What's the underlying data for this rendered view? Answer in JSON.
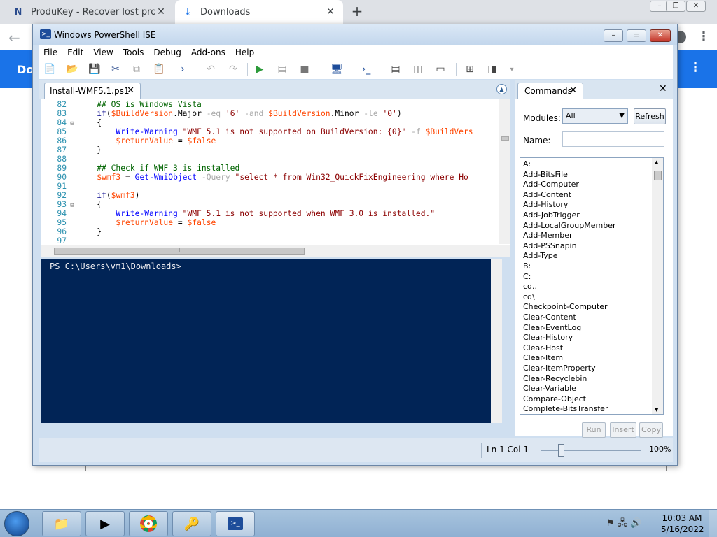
{
  "browser": {
    "tabs": [
      {
        "label": "ProduKey - Recover lost product",
        "icon": "N"
      },
      {
        "label": "Downloads",
        "icon": "download-icon"
      }
    ],
    "new_tab": "+",
    "page_title": "Dow"
  },
  "ise": {
    "title": "Windows PowerShell ISE",
    "menu": [
      "File",
      "Edit",
      "View",
      "Tools",
      "Debug",
      "Add-ons",
      "Help"
    ],
    "script_tab": "Install-WMF5.1.ps1",
    "code_lines": [
      {
        "n": "82",
        "fold": "",
        "text": "    ## OS is Windows Vista"
      },
      {
        "n": "83",
        "fold": "",
        "text": "    if($BuildVersion.Major -eq '6' -and $BuildVersion.Minor -le '0')"
      },
      {
        "n": "84",
        "fold": "⊟",
        "text": "    {"
      },
      {
        "n": "85",
        "fold": "",
        "text": "        Write-Warning \"WMF 5.1 is not supported on BuildVersion: {0}\" -f $BuildVers"
      },
      {
        "n": "86",
        "fold": "",
        "text": "        $returnValue = $false"
      },
      {
        "n": "87",
        "fold": "",
        "text": "    }"
      },
      {
        "n": "88",
        "fold": "",
        "text": ""
      },
      {
        "n": "89",
        "fold": "",
        "text": "    ## Check if WMF 3 is installed"
      },
      {
        "n": "90",
        "fold": "",
        "text": "    $wmf3 = Get-WmiObject -Query \"select * from Win32_QuickFixEngineering where Ho"
      },
      {
        "n": "91",
        "fold": "",
        "text": ""
      },
      {
        "n": "92",
        "fold": "",
        "text": "    if($wmf3)"
      },
      {
        "n": "93",
        "fold": "⊟",
        "text": "    {"
      },
      {
        "n": "94",
        "fold": "",
        "text": "        Write-Warning \"WMF 5.1 is not supported when WMF 3.0 is installed.\""
      },
      {
        "n": "95",
        "fold": "",
        "text": "        $returnValue = $false"
      },
      {
        "n": "96",
        "fold": "",
        "text": "    }"
      },
      {
        "n": "97",
        "fold": "",
        "text": ""
      }
    ],
    "console_prompt": "PS C:\\Users\\vm1\\Downloads>",
    "commands": {
      "tab_label": "Commands",
      "modules_label": "Modules:",
      "modules_value": "All",
      "refresh_label": "Refresh",
      "name_label": "Name:",
      "items": [
        "A:",
        "Add-BitsFile",
        "Add-Computer",
        "Add-Content",
        "Add-History",
        "Add-JobTrigger",
        "Add-LocalGroupMember",
        "Add-Member",
        "Add-PSSnapin",
        "Add-Type",
        "B:",
        "C:",
        "cd..",
        "cd\\",
        "Checkpoint-Computer",
        "Clear-Content",
        "Clear-EventLog",
        "Clear-History",
        "Clear-Host",
        "Clear-Item",
        "Clear-ItemProperty",
        "Clear-Recyclebin",
        "Clear-Variable",
        "Compare-Object",
        "Complete-BitsTransfer"
      ],
      "run_label": "Run",
      "insert_label": "Insert",
      "copy_label": "Copy"
    },
    "status": {
      "position": "Ln 1  Col 1",
      "zoom": "100%"
    }
  },
  "taskbar": {
    "time": "10:03 AM",
    "date": "5/16/2022"
  },
  "colors": {
    "console_bg": "#012456",
    "chrome_accent": "#1a73e8",
    "keyword": "#00008b",
    "variable": "#ff4500",
    "string": "#8b0000",
    "comment": "#006400"
  }
}
